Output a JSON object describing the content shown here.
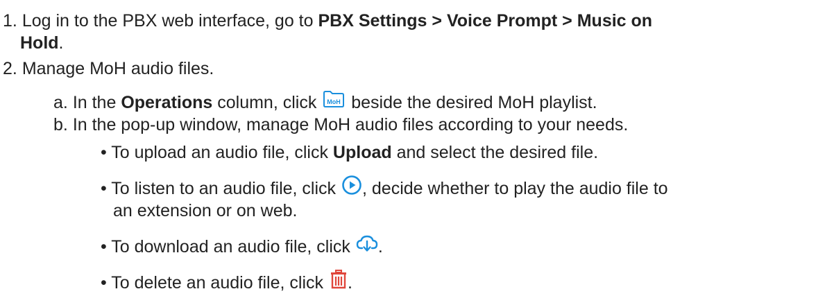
{
  "steps": {
    "s1": {
      "num": "1.",
      "pre": "Log in to the PBX web interface, go to ",
      "path": "PBX Settings > Voice Prompt > Music on",
      "path_end": "Hold",
      "end": "."
    },
    "s2": {
      "num": "2.",
      "text": "Manage MoH audio files."
    }
  },
  "substeps": {
    "a": {
      "marker": "a.",
      "pre": "In the ",
      "bold": "Operations",
      "mid": " column, click ",
      "icon": "moh-folder-icon",
      "icon_text": "MoH",
      "post": " beside the desired MoH playlist."
    },
    "b": {
      "marker": "b.",
      "text": "In the pop-up window, manage MoH audio files according to your needs."
    }
  },
  "bullets": {
    "upload": {
      "marker": "•",
      "pre": "To upload an audio file, click ",
      "bold": "Upload",
      "post": " and select the desired file."
    },
    "listen": {
      "marker": "•",
      "pre": "To listen to an audio file, click ",
      "icon": "play-circle-icon",
      "post": ", decide whether to play the audio file to",
      "cont": "an extension or on web."
    },
    "download": {
      "marker": "•",
      "pre": "To download an audio file, click ",
      "icon": "cloud-download-icon",
      "post": "."
    },
    "delete": {
      "marker": "•",
      "pre": "To delete an audio file, click ",
      "icon": "trash-icon",
      "post": "."
    }
  },
  "colors": {
    "text": "#222222",
    "icon_blue": "#1a8fdd",
    "icon_red": "#e0463b"
  }
}
